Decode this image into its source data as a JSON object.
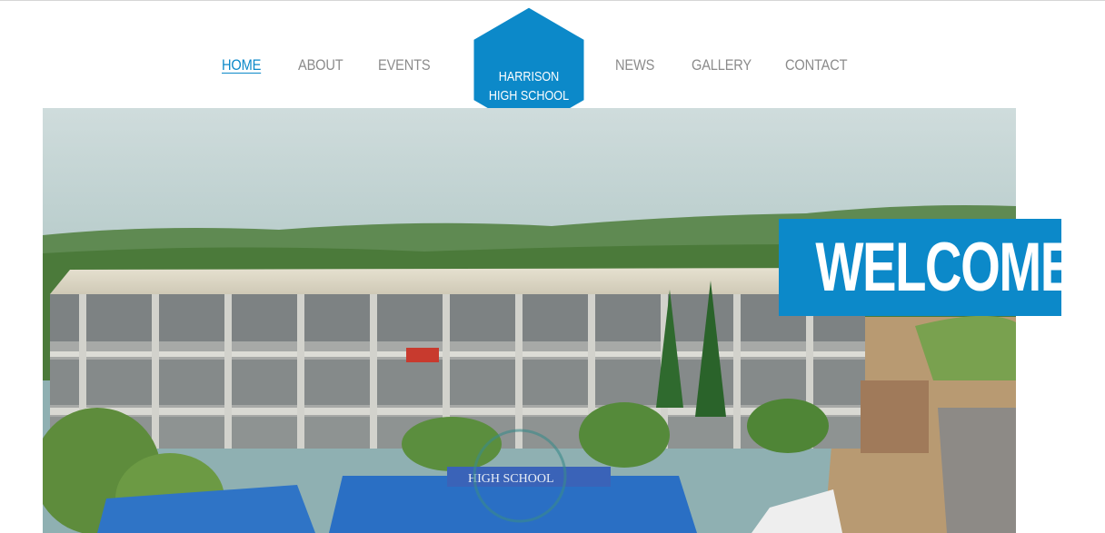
{
  "nav": {
    "left": [
      {
        "label": "HOME",
        "active": true
      },
      {
        "label": "ABOUT",
        "active": false
      },
      {
        "label": "EVENTS",
        "active": false
      }
    ],
    "right": [
      {
        "label": "NEWS",
        "active": false
      },
      {
        "label": "GALLERY",
        "active": false
      },
      {
        "label": "CONTACT",
        "active": false
      }
    ]
  },
  "logo": {
    "line1": "HARRISON",
    "line2": "HIGH SCHOOL",
    "icon": "graduation-cap-icon"
  },
  "hero": {
    "banner_text": "WELCOME!",
    "sign_text": "HIGH SCHOOL"
  },
  "colors": {
    "accent": "#0c89c9",
    "nav_text": "#8b8b8b",
    "background": "#ffffff"
  }
}
